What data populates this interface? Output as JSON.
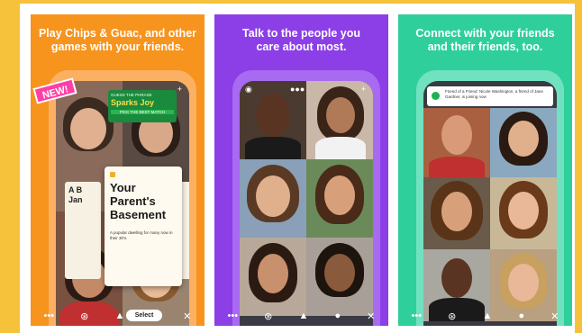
{
  "panels": [
    {
      "caption_line1": "Play Chips & Guac, and other",
      "caption_line2": "games with your friends.",
      "badge": "NEW!",
      "game_header_small": "GUESS THE PHRASE",
      "game_header_big": "Sparks Joy",
      "game_header_button": "PICK THE BEST MATCH",
      "left_card_text": "A B Jan",
      "main_card_title": "Your Parent's Basement",
      "main_card_desc": "A popular dwelling for many now in their 30's.",
      "right_card_text": "",
      "select_label": "Select"
    },
    {
      "caption_line1": "Talk to the people you",
      "caption_line2": "care about most."
    },
    {
      "caption_line1": "Connect with your friends",
      "caption_line2": "and their friends, too.",
      "notification_text": "Friend of a Friend: Nicole Washington, a friend of Jane Gardner, is joining now"
    }
  ],
  "icons": {
    "more": "•••",
    "add": "+",
    "mic": "🎙",
    "close": "✕"
  },
  "colors": {
    "frame": "#f7c23b",
    "panel1": "#f7941d",
    "panel2": "#8c3fe6",
    "panel3": "#2fcf9b"
  }
}
